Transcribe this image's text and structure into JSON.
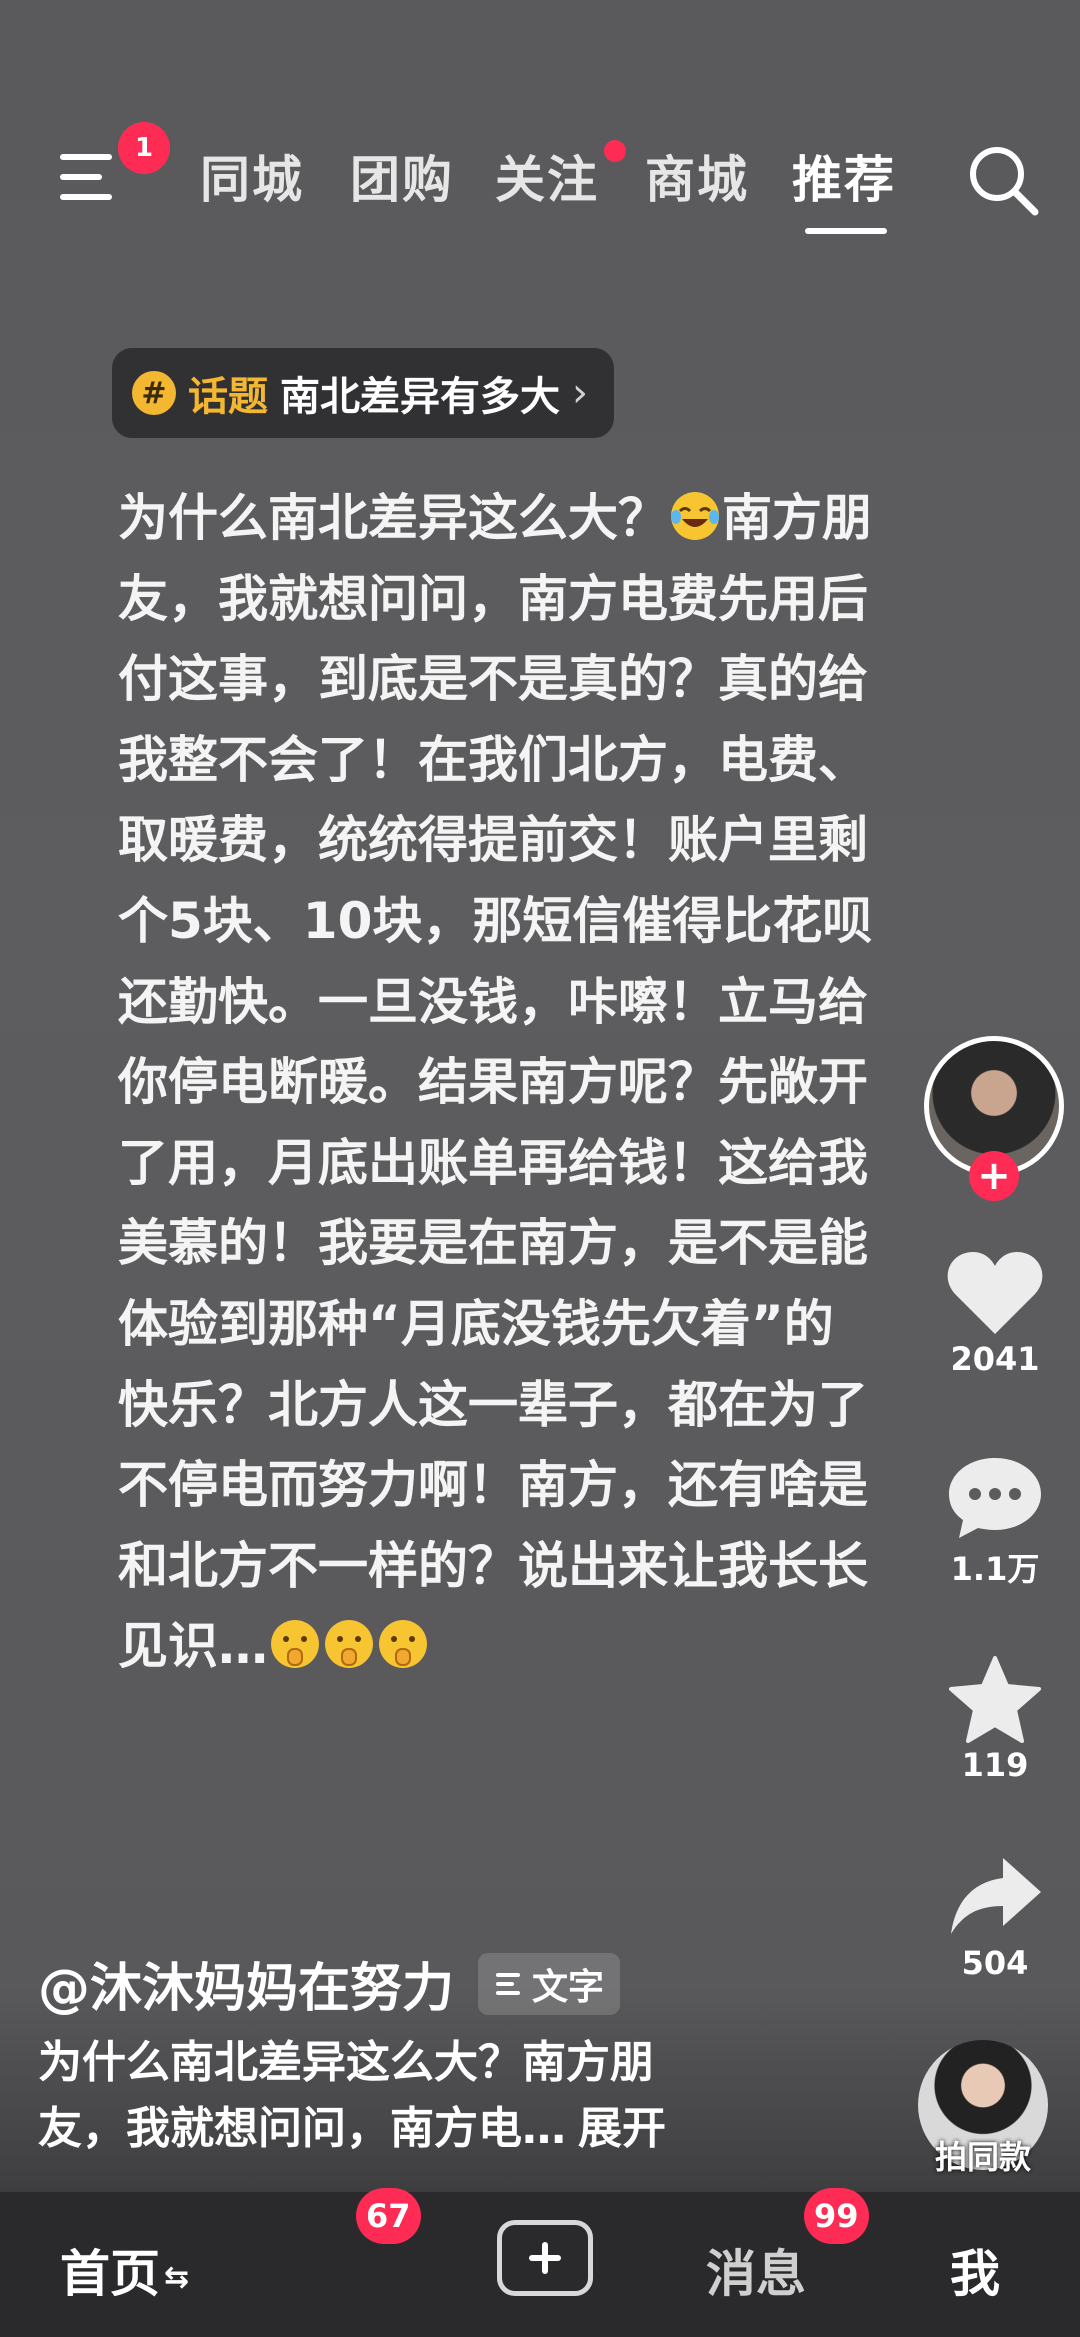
{
  "top_nav": {
    "menu_badge": "1",
    "tabs": [
      {
        "label": "同城",
        "active": false
      },
      {
        "label": "团购",
        "active": false
      },
      {
        "label": "关注",
        "active": false,
        "dot": true
      },
      {
        "label": "商城",
        "active": false
      },
      {
        "label": "推荐",
        "active": true
      }
    ]
  },
  "topic": {
    "label": "话题",
    "name": "南北差异有多大",
    "icon": "hash-icon"
  },
  "post": {
    "lines": [
      "为什么南北差异这么大？",
      "南方朋",
      "友，我就想问问，南方电费先用后",
      "付这事，到底是不是真的？真的给",
      "我整不会了！在我们北方，电费、",
      "取暖费，统统得提前交！账户里剩",
      "个5块、10块，那短信催得比花呗",
      "还勤快。一旦没钱，咔嚓！立马给",
      "你停电断暖。结果南方呢？先敞开",
      "了用，月底出账单再给钱！这给我",
      "美慕的！我要是在南方，是不是能",
      "体验到那种“月底没钱先欠着”的",
      "快乐？北方人这一辈子，都在为了",
      "不停电而努力啊！南方，还有啥是",
      "和北方不一样的？说出来让我长长",
      "见识…"
    ],
    "emojis": [
      "laughing-crying-emoji",
      "shushing-face-emoji",
      "shushing-face-emoji",
      "shushing-face-emoji"
    ]
  },
  "rail": {
    "like_count": "2041",
    "comment_count": "1.1万",
    "favorite_count": "119",
    "share_count": "504",
    "same_style_label": "拍同款"
  },
  "author": {
    "name": "@沐沐妈妈在努力",
    "tag": "文字"
  },
  "caption": {
    "line1": "为什么南北差异这么大？南方朋",
    "line2": "友，我就想问问，南方电…",
    "more": "展开"
  },
  "bottom_nav": {
    "home": "首页",
    "home_badge": "67",
    "messages": "消息",
    "messages_badge": "99",
    "me": "我"
  },
  "colors": {
    "accent": "#fe2c55",
    "topic": "#f4b731"
  }
}
